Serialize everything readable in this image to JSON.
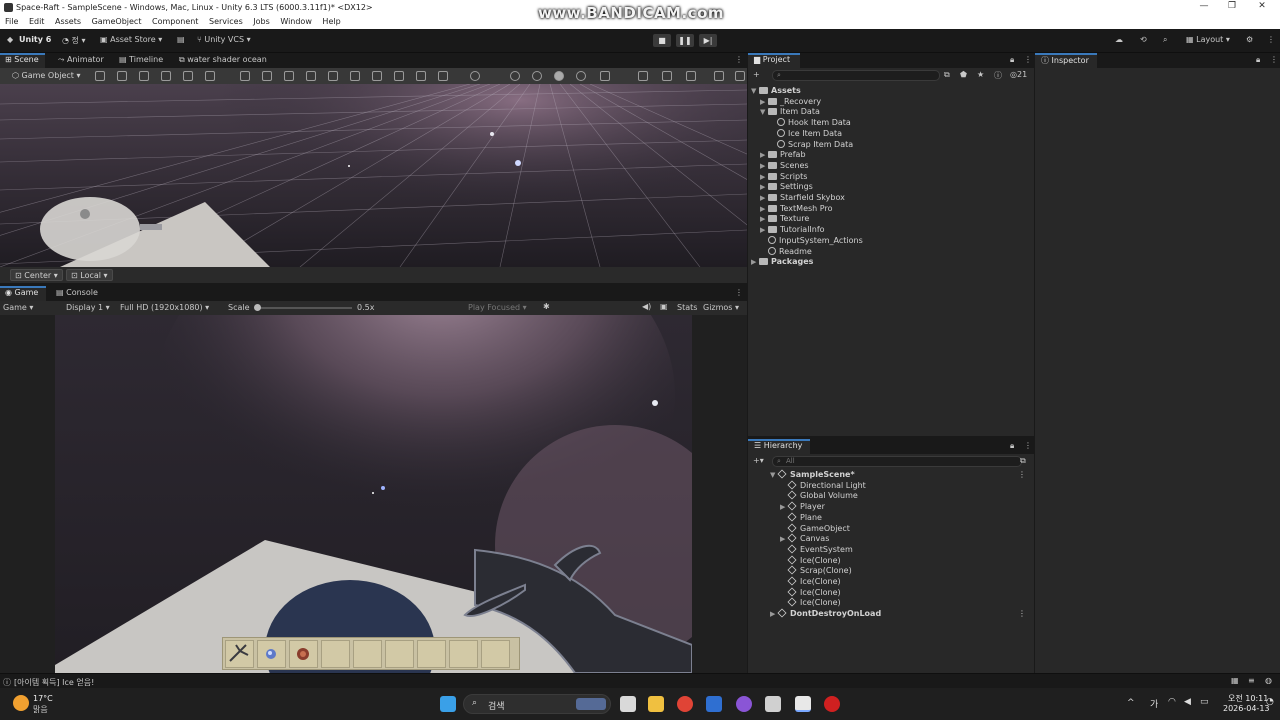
{
  "window": {
    "title": "Space-Raft - SampleScene - Windows, Mac, Linux - Unity 6.3 LTS (6000.3.11f1)* <DX12>",
    "watermark": "www.BANDICAM.com",
    "controls": [
      "—",
      "❐",
      "✕"
    ]
  },
  "menu": [
    "File",
    "Edit",
    "Assets",
    "GameObject",
    "Component",
    "Services",
    "Jobs",
    "Window",
    "Help"
  ],
  "toolbar": {
    "account": "Unity 6",
    "user": "정",
    "asset_store": "Asset Store",
    "vcs": "Unity VCS",
    "layout": "Layout"
  },
  "scene_tabs": [
    "Scene",
    "Animator",
    "Timeline",
    "water shader ocean"
  ],
  "scene_tools": {
    "mode": "Game Object",
    "pivot": "Center",
    "space": "Local"
  },
  "game_tabs": [
    "Game",
    "Console"
  ],
  "game_bar": {
    "view": "Game",
    "display": "Display 1",
    "resolution": "Full HD (1920x1080)",
    "scale_label": "Scale",
    "scale_value": "0.5x",
    "play_mode": "Play Focused",
    "stats": "Stats",
    "gizmos": "Gizmos"
  },
  "hotbar": {
    "filled_slots": 3,
    "total_slots": 9
  },
  "project": {
    "tab": "Project",
    "count": "21",
    "tree": [
      {
        "label": "Assets",
        "depth": 0,
        "expanded": true,
        "type": "folder",
        "bold": true
      },
      {
        "label": "_Recovery",
        "depth": 1,
        "type": "folder"
      },
      {
        "label": "Item Data",
        "depth": 1,
        "expanded": true,
        "type": "folder"
      },
      {
        "label": "Hook Item Data",
        "depth": 2,
        "type": "asset"
      },
      {
        "label": "Ice Item Data",
        "depth": 2,
        "type": "asset"
      },
      {
        "label": "Scrap Item Data",
        "depth": 2,
        "type": "asset"
      },
      {
        "label": "Prefab",
        "depth": 1,
        "type": "folder"
      },
      {
        "label": "Scenes",
        "depth": 1,
        "type": "folder"
      },
      {
        "label": "Scripts",
        "depth": 1,
        "type": "folder"
      },
      {
        "label": "Settings",
        "depth": 1,
        "type": "folder"
      },
      {
        "label": "Starfield Skybox",
        "depth": 1,
        "type": "folder"
      },
      {
        "label": "TextMesh Pro",
        "depth": 1,
        "type": "folder"
      },
      {
        "label": "Texture",
        "depth": 1,
        "type": "folder"
      },
      {
        "label": "TutorialInfo",
        "depth": 1,
        "type": "folder"
      },
      {
        "label": "InputSystem_Actions",
        "depth": 1,
        "type": "asset"
      },
      {
        "label": "Readme",
        "depth": 1,
        "type": "asset"
      },
      {
        "label": "Packages",
        "depth": 0,
        "type": "folder",
        "bold": true
      }
    ]
  },
  "hierarchy": {
    "tab": "Hierarchy",
    "search_placeholder": "All",
    "items": [
      {
        "label": "SampleScene*",
        "depth": 0,
        "scene": true
      },
      {
        "label": "Directional Light",
        "depth": 1
      },
      {
        "label": "Global Volume",
        "depth": 1
      },
      {
        "label": "Player",
        "depth": 1,
        "arrow": true
      },
      {
        "label": "Plane",
        "depth": 1
      },
      {
        "label": "GameObject",
        "depth": 1
      },
      {
        "label": "Canvas",
        "depth": 1,
        "arrow": true
      },
      {
        "label": "EventSystem",
        "depth": 1
      },
      {
        "label": "Ice(Clone)",
        "depth": 1
      },
      {
        "label": "Scrap(Clone)",
        "depth": 1
      },
      {
        "label": "Ice(Clone)",
        "depth": 1
      },
      {
        "label": "Ice(Clone)",
        "depth": 1
      },
      {
        "label": "Ice(Clone)",
        "depth": 1
      },
      {
        "label": "DontDestroyOnLoad",
        "depth": 0,
        "scene": true
      }
    ]
  },
  "inspector": {
    "tab": "Inspector"
  },
  "status": {
    "message": "[아이템 획득] Ice 얻음!"
  },
  "taskbar": {
    "weather_temp": "17°C",
    "weather_desc": "맑음",
    "search": "검색",
    "time": "오전 10:11",
    "date": "2026-04-13",
    "lang": "가"
  },
  "colors": {
    "accent": "#3a79bb",
    "panel": "#282828",
    "dark": "#191919",
    "sky": "#3d3540",
    "nebula": "#8a6f84"
  }
}
